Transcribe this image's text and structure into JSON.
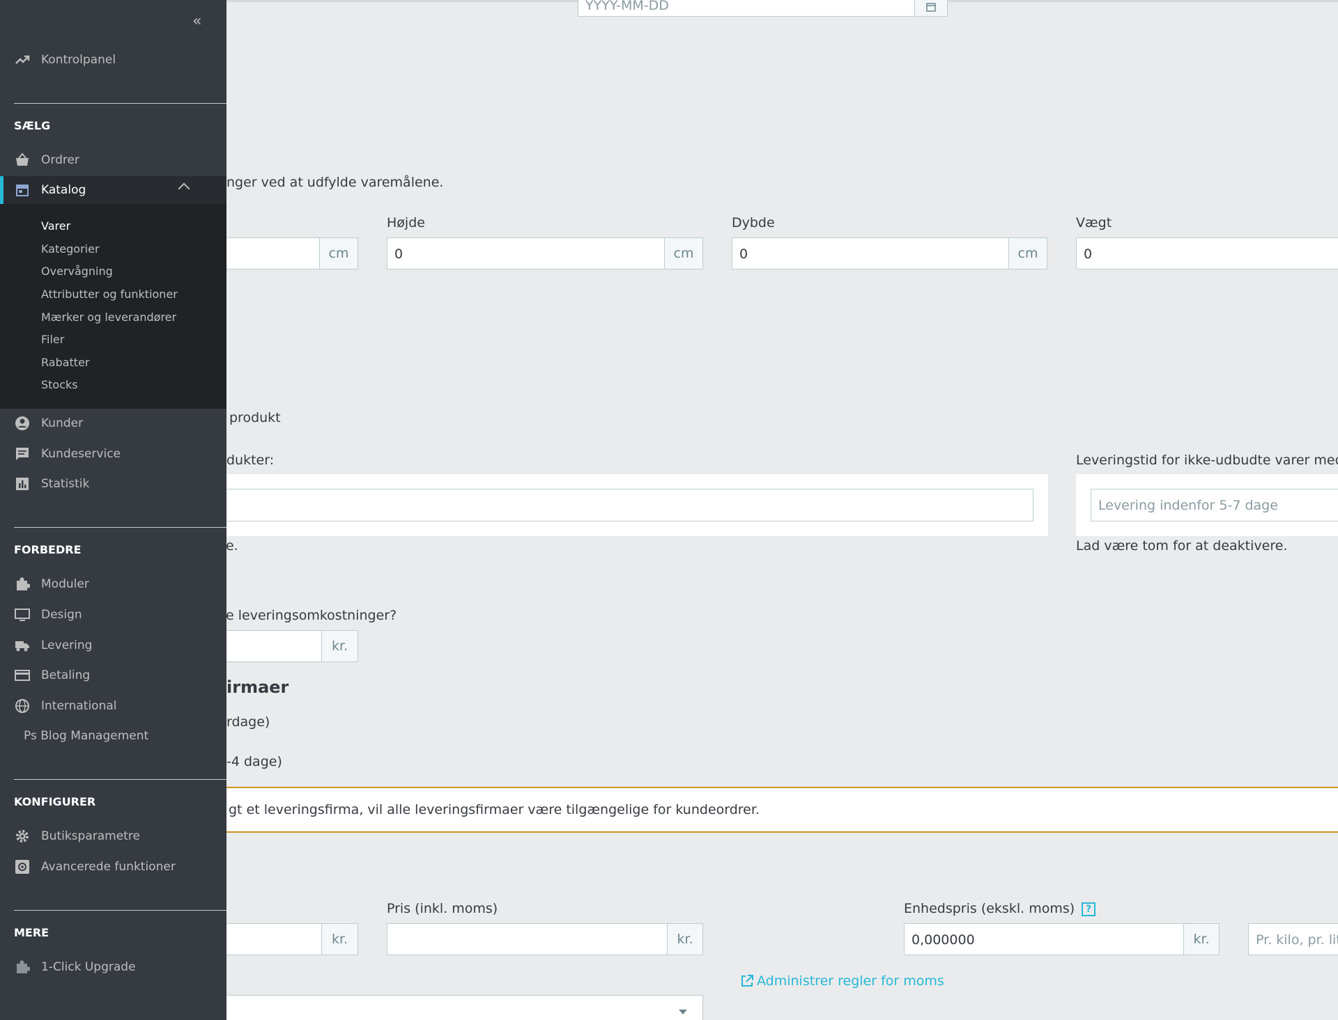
{
  "form": {
    "date_placeholder": "YYYY-MM-DD",
    "dimensions_intro": "nger ved at udfylde varemålene.",
    "height_label": "Højde",
    "depth_label": "Dybde",
    "weight_label": "Vægt",
    "width_value": "",
    "height_value": "0",
    "depth_value": "0",
    "weight_value": "0",
    "unit_cm": "cm",
    "produkt_text": "produkt",
    "products_label_fragment": "dukter:",
    "delivery_time_label": "Leveringstid for ikke-udbudte varer med til",
    "delivery_time_placeholder": "Levering indenfor 5-7 dage",
    "empty_hint_fragment": "e.",
    "empty_hint": "Lad være tom for at deaktivere.",
    "shipping_cost_question": "e leveringsomkostninger?",
    "currency": "kr.",
    "carriers_title_fragment": "irmaer",
    "carrier_option_1": "rdage)",
    "carrier_option_2": "-4 dage)",
    "carrier_warning": "gt et leveringsfirma, vil alle leveringsfirmaer være tilgængelige for kundeordrer.",
    "price_incl_label": "Pris (inkl. moms)",
    "unit_price_label": "Enhedspris (ekskl. moms)",
    "unit_price_value": "0,000000",
    "unit_per_placeholder": "Pr. kilo, pr. liter",
    "manage_tax_link": "Administrer regler for moms",
    "help_icon_text": "?"
  },
  "sidebar": {
    "collapse_icon": "«",
    "dashboard": "Kontrolpanel",
    "sell_heading": "SÆLG",
    "orders": "Ordrer",
    "catalog": "Katalog",
    "catalog_items": [
      "Varer",
      "Kategorier",
      "Overvågning",
      "Attributter og funktioner",
      "Mærker og leverandører",
      "Filer",
      "Rabatter",
      "Stocks"
    ],
    "customers": "Kunder",
    "customer_service": "Kundeservice",
    "statistics": "Statistik",
    "improve_heading": "FORBEDRE",
    "modules": "Moduler",
    "design": "Design",
    "shipping": "Levering",
    "payment": "Betaling",
    "international": "International",
    "blog": "Ps Blog Management",
    "configure_heading": "KONFIGURER",
    "shop_parameters": "Butiksparametre",
    "advanced": "Avancerede funktioner",
    "more_heading": "MERE",
    "upgrade": "1-Click Upgrade"
  },
  "colors": {
    "sidebar_bg": "#363a41",
    "submenu_bg": "#202226",
    "accent": "#25b9d7",
    "warning": "#cd9321",
    "content_bg": "#eaebec"
  }
}
